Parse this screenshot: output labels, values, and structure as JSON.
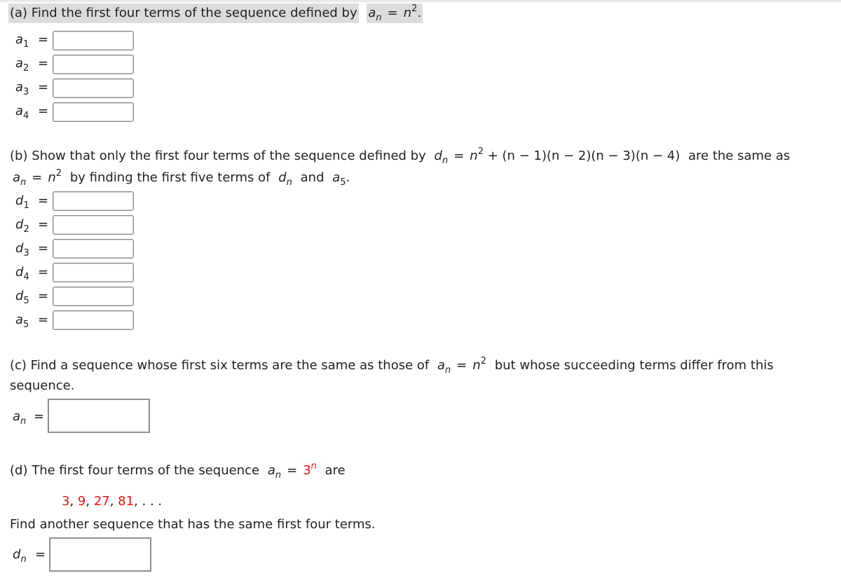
{
  "part_a": {
    "prompt": "(a) Find the first four terms of the sequence defined by",
    "formula": {
      "lhs": "a",
      "lhs_sub": "n",
      "rhs_base": "n",
      "rhs_exp": "2",
      "end": "."
    },
    "rows": [
      {
        "var": "a",
        "sub": "1",
        "value": ""
      },
      {
        "var": "a",
        "sub": "2",
        "value": ""
      },
      {
        "var": "a",
        "sub": "3",
        "value": ""
      },
      {
        "var": "a",
        "sub": "4",
        "value": ""
      }
    ]
  },
  "part_b": {
    "prompt_1": "(b) Show that only the first four terms of the sequence defined by",
    "formula_d": {
      "lhs": "d",
      "lhs_sub": "n",
      "rhs": "n",
      "rhs_exp": "2",
      "rest": "+ (n − 1)(n − 2)(n − 3)(n − 4)"
    },
    "prompt_2": "are the same as",
    "line2_formula": {
      "lhs": "a",
      "lhs_sub": "n",
      "rhs": "n",
      "rhs_exp": "2"
    },
    "line2_text": "by finding the first five terms of",
    "line2_d": {
      "var": "d",
      "sub": "n"
    },
    "line2_and": "and",
    "line2_a5": {
      "var": "a",
      "sub": "5",
      "end": "."
    },
    "rows": [
      {
        "var": "d",
        "sub": "1",
        "value": ""
      },
      {
        "var": "d",
        "sub": "2",
        "value": ""
      },
      {
        "var": "d",
        "sub": "3",
        "value": ""
      },
      {
        "var": "d",
        "sub": "4",
        "value": ""
      },
      {
        "var": "d",
        "sub": "5",
        "value": ""
      },
      {
        "var": "a",
        "sub": "5",
        "value": ""
      }
    ]
  },
  "part_c": {
    "prompt_1": "(c) Find a sequence whose first six terms are the same as those of",
    "formula": {
      "lhs": "a",
      "lhs_sub": "n",
      "rhs": "n",
      "rhs_exp": "2"
    },
    "prompt_2": "but whose succeeding terms differ from this",
    "prompt_3": "sequence.",
    "answer": {
      "var": "a",
      "sub": "n",
      "value": ""
    }
  },
  "part_d": {
    "prompt_1": "(d) The first four terms of the sequence",
    "formula": {
      "lhs": "a",
      "lhs_sub": "n",
      "rhs_base": "3",
      "rhs_exp": "n"
    },
    "prompt_2": "are",
    "terms": [
      "3",
      "9",
      "27",
      "81"
    ],
    "ellipsis": ". . .",
    "prompt_3": "Find another sequence that has the same first four terms.",
    "answer": {
      "var": "d",
      "sub": "n",
      "value": ""
    },
    "accent_color": "#ee1111"
  }
}
